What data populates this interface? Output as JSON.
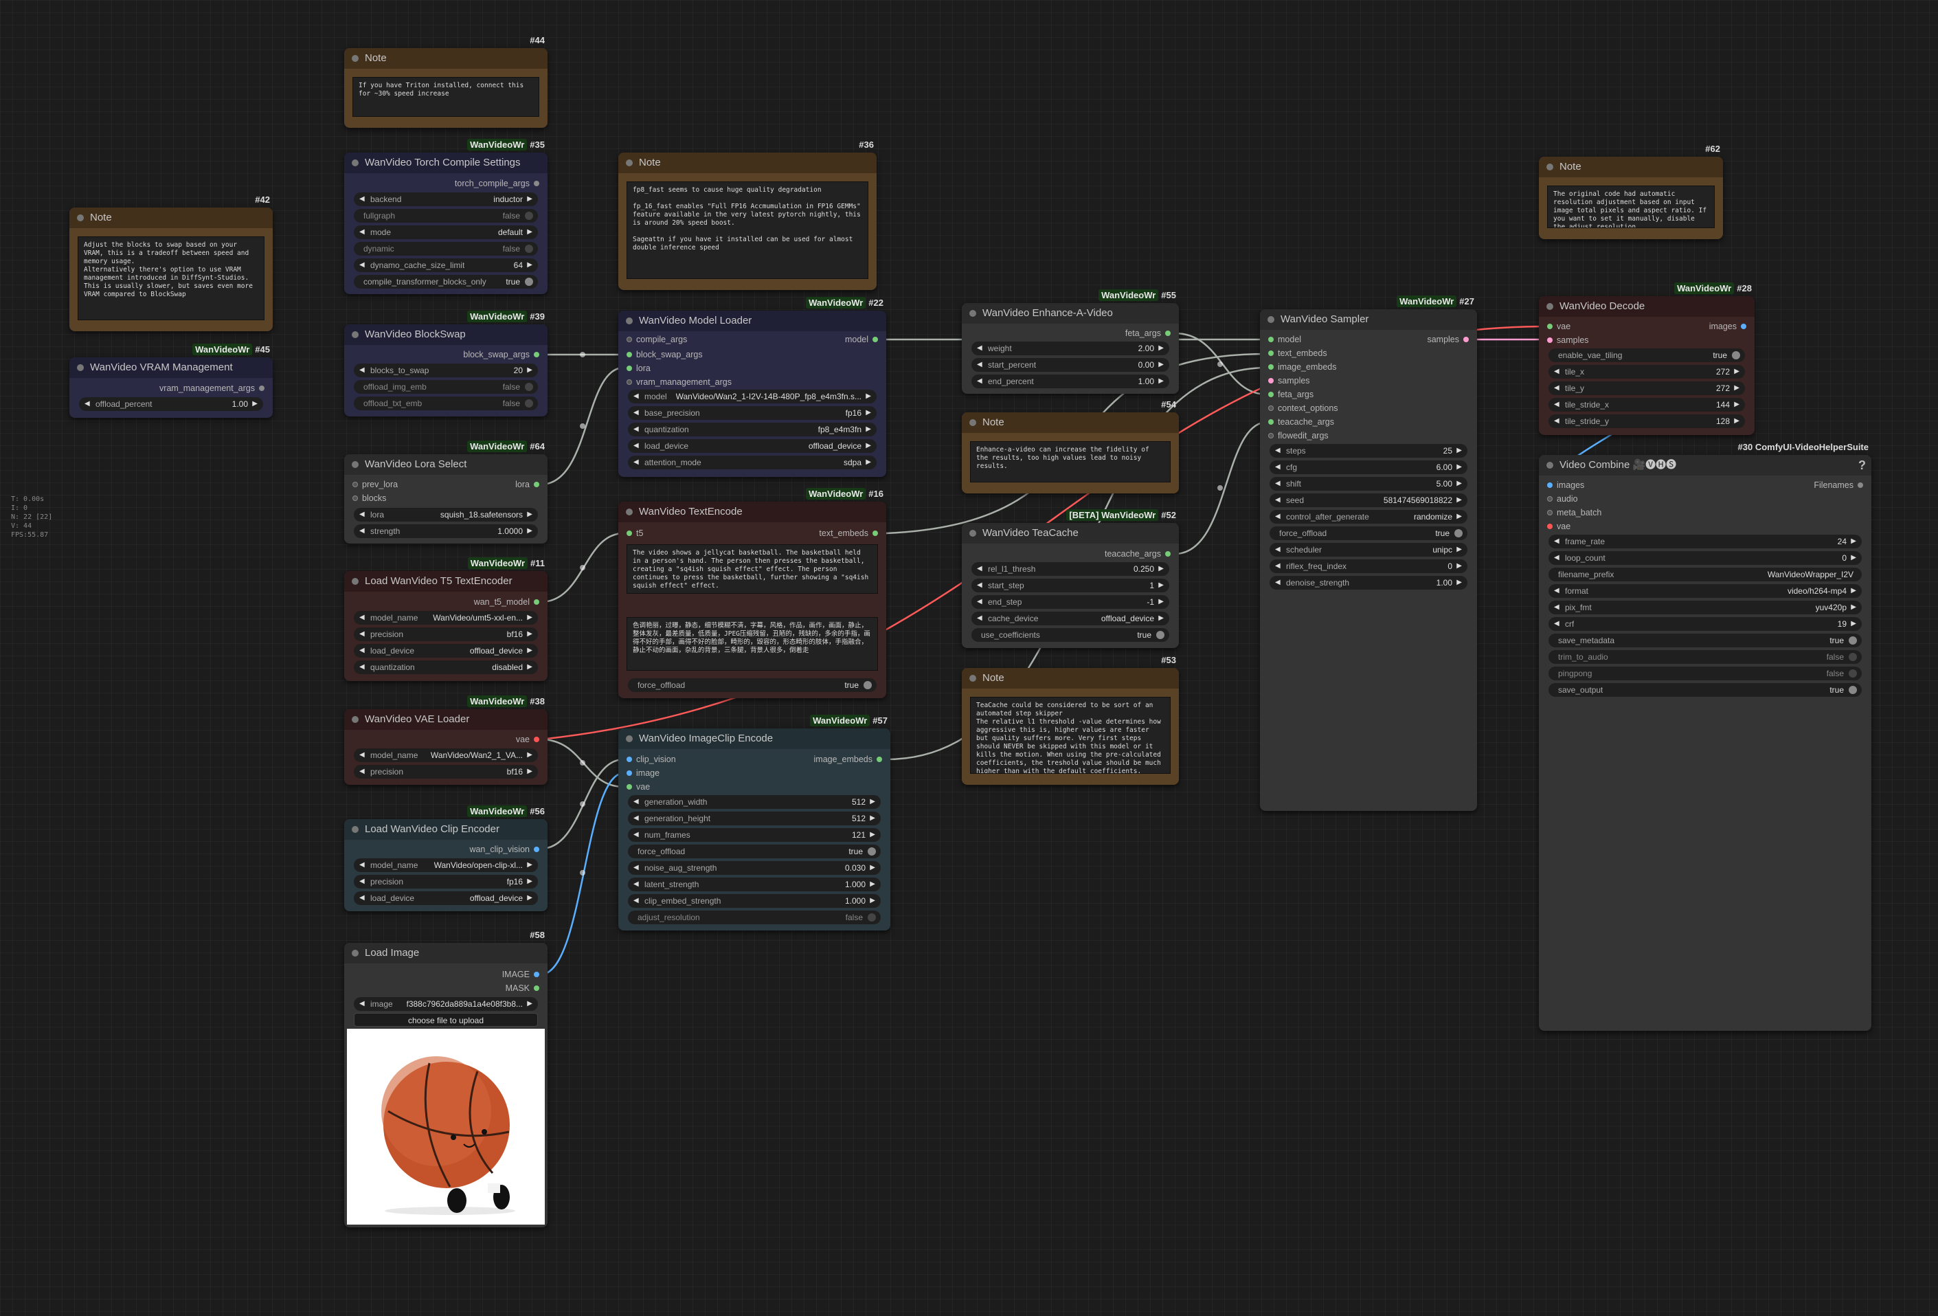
{
  "stats": [
    "T: 0.00s",
    "I: 0",
    "N: 22 [22]",
    "V: 44",
    "FPS:55.87"
  ],
  "nodes": {
    "n44": {
      "id": "#44",
      "title": "Note",
      "text": "If you have Triton installed, connect this for ~30% speed increase"
    },
    "n42": {
      "id": "#42",
      "title": "Note",
      "text": "Adjust the blocks to swap based on your VRAM, this is a tradeoff between speed and memory usage.\nAlternatively there's option to use VRAM management introduced in DiffSynt-Studios. This is usually slower, but saves even more VRAM compared to BlockSwap"
    },
    "n36": {
      "id": "#36",
      "title": "Note",
      "text": "fp8_fast seems to cause huge quality degradation\n\nfp_16_fast enables \"Full FP16 Accmumulation in FP16 GEMMs\" feature available in the very latest pytorch nightly, this is around 20% speed boost.\n\nSageattn if you have it installed can be used for almost double inference speed"
    },
    "n62": {
      "id": "#62",
      "title": "Note",
      "text": "The original code had automatic resolution adjustment based on input image total pixels and aspect ratio. If you want to set it manually, disable the adjust_resolution"
    },
    "n54": {
      "id": "#54",
      "title": "Note",
      "text": "Enhance-a-video can increase the fidelity of the results, too high values lead to noisy results."
    },
    "n53": {
      "id": "#53",
      "title": "Note",
      "text": "TeaCache could be considered to be sort of an automated step skipper\nThe relative l1 threshold -value determines how aggressive this is, higher values are faster but quality suffers more. Very first steps should NEVER be skipped with this model or it kills the motion. When using the pre-calculated coefficients, the treshold value should be much higher than with the default coefficients."
    },
    "n35": {
      "badge": "WanVideoWr",
      "id": "#35",
      "title": "WanVideo Torch Compile Settings",
      "output": "torch_compile_args",
      "widgets": [
        [
          "backend",
          "inductor"
        ],
        [
          "fullgraph",
          "false"
        ],
        [
          "mode",
          "default"
        ],
        [
          "dynamic",
          "false"
        ],
        [
          "dynamo_cache_size_limit",
          "64"
        ],
        [
          "compile_transformer_blocks_only",
          "true"
        ]
      ]
    },
    "n39": {
      "badge": "WanVideoWr",
      "id": "#39",
      "title": "WanVideo BlockSwap",
      "output": "block_swap_args",
      "widgets": [
        [
          "blocks_to_swap",
          "20"
        ],
        [
          "offload_img_emb",
          "false"
        ],
        [
          "offload_txt_emb",
          "false"
        ]
      ]
    },
    "n45": {
      "badge": "WanVideoWr",
      "id": "#45",
      "title": "WanVideo VRAM Management",
      "output": "vram_management_args",
      "widgets": [
        [
          "offload_percent",
          "1.00"
        ]
      ]
    },
    "n64": {
      "badge": "WanVideoWr",
      "id": "#64",
      "title": "WanVideo Lora Select",
      "inputs": [
        "prev_lora",
        "blocks"
      ],
      "output": "lora",
      "widgets": [
        [
          "lora",
          "squish_18.safetensors"
        ],
        [
          "strength",
          "1.0000"
        ]
      ]
    },
    "n11": {
      "badge": "WanVideoWr",
      "id": "#11",
      "title": "Load WanVideo T5 TextEncoder",
      "output": "wan_t5_model",
      "widgets": [
        [
          "model_name",
          "WanVideo/umt5-xxl-en..."
        ],
        [
          "precision",
          "bf16"
        ],
        [
          "load_device",
          "offload_device"
        ],
        [
          "quantization",
          "disabled"
        ]
      ]
    },
    "n38": {
      "badge": "WanVideoWr",
      "id": "#38",
      "title": "WanVideo VAE Loader",
      "output": "vae",
      "widgets": [
        [
          "model_name",
          "WanVideo/Wan2_1_VA..."
        ],
        [
          "precision",
          "bf16"
        ]
      ]
    },
    "n56": {
      "badge": "WanVideoWr",
      "id": "#56",
      "title": "Load WanVideo Clip Encoder",
      "output": "wan_clip_vision",
      "widgets": [
        [
          "model_name",
          "WanVideo/open-clip-xl..."
        ],
        [
          "precision",
          "fp16"
        ],
        [
          "load_device",
          "offload_device"
        ]
      ]
    },
    "n58": {
      "id": "#58",
      "title": "Load Image",
      "outputs": [
        "IMAGE",
        "MASK"
      ],
      "widgets": [
        [
          "image",
          "f388c7962da889a1a4e08f3b8..."
        ]
      ],
      "upload": "choose file to upload"
    },
    "n22": {
      "badge": "WanVideoWr",
      "id": "#22",
      "title": "WanVideo Model Loader",
      "inputs": [
        "compile_args",
        "block_swap_args",
        "lora",
        "vram_management_args"
      ],
      "output": "model",
      "widgets": [
        [
          "model",
          "WanVideo/Wan2_1-I2V-14B-480P_fp8_e4m3fn.s..."
        ],
        [
          "base_precision",
          "fp16"
        ],
        [
          "quantization",
          "fp8_e4m3fn"
        ],
        [
          "load_device",
          "offload_device"
        ],
        [
          "attention_mode",
          "sdpa"
        ]
      ]
    },
    "n16": {
      "badge": "WanVideoWr",
      "id": "#16",
      "title": "WanVideo TextEncode",
      "input": "t5",
      "output": "text_embeds",
      "positive": "The video shows a jellycat basketball. The basketball held in a person's hand. The person then presses the basketball, creating a \"sq4ish squish effect\" effect. The person continues to press the basketball, further showing a \"sq4ish squish effect\" effect.",
      "negative": "色调艳丽，过曝，静态，细节模糊不清，字幕，风格，作品，画作，画面，静止，整体发灰，最差质量，低质量，JPEG压缩残留，丑陋的，残缺的，多余的手指，画得不好的手部，画得不好的脸部，畸形的，毁容的，形态畸形的肢体，手指融合，静止不动的画面，杂乱的背景，三条腿，背景人很多，倒着走",
      "widgets": [
        [
          "force_offload",
          "true"
        ]
      ]
    },
    "n57": {
      "badge": "WanVideoWr",
      "id": "#57",
      "title": "WanVideo ImageClip Encode",
      "inputs": [
        "clip_vision",
        "image",
        "vae"
      ],
      "output": "image_embeds",
      "widgets": [
        [
          "generation_width",
          "512"
        ],
        [
          "generation_height",
          "512"
        ],
        [
          "num_frames",
          "121"
        ],
        [
          "force_offload",
          "true"
        ],
        [
          "noise_aug_strength",
          "0.030"
        ],
        [
          "latent_strength",
          "1.000"
        ],
        [
          "clip_embed_strength",
          "1.000"
        ],
        [
          "adjust_resolution",
          "false"
        ]
      ]
    },
    "n55": {
      "badge": "WanVideoWr",
      "id": "#55",
      "title": "WanVideo Enhance-A-Video",
      "output": "feta_args",
      "widgets": [
        [
          "weight",
          "2.00"
        ],
        [
          "start_percent",
          "0.00"
        ],
        [
          "end_percent",
          "1.00"
        ]
      ]
    },
    "n52": {
      "badge": "[BETA] WanVideoWr",
      "id": "#52",
      "title": "WanVideo TeaCache",
      "output": "teacache_args",
      "widgets": [
        [
          "rel_l1_thresh",
          "0.250"
        ],
        [
          "start_step",
          "1"
        ],
        [
          "end_step",
          "-1"
        ],
        [
          "cache_device",
          "offload_device"
        ],
        [
          "use_coefficients",
          "true"
        ]
      ]
    },
    "n27": {
      "badge": "WanVideoWr",
      "id": "#27",
      "title": "WanVideo Sampler",
      "inputs": [
        "model",
        "text_embeds",
        "image_embeds",
        "samples",
        "feta_args",
        "context_options",
        "teacache_args",
        "flowedit_args"
      ],
      "output": "samples",
      "widgets": [
        [
          "steps",
          "25"
        ],
        [
          "cfg",
          "6.00"
        ],
        [
          "shift",
          "5.00"
        ],
        [
          "seed",
          "581474569018822"
        ],
        [
          "control_after_generate",
          "randomize"
        ],
        [
          "force_offload",
          "true"
        ],
        [
          "scheduler",
          "unipc"
        ],
        [
          "riflex_freq_index",
          "0"
        ],
        [
          "denoise_strength",
          "1.00"
        ]
      ]
    },
    "n28": {
      "badge": "WanVideoWr",
      "id": "#28",
      "title": "WanVideo Decode",
      "inputs": [
        "vae",
        "samples"
      ],
      "output": "images",
      "widgets": [
        [
          "enable_vae_tiling",
          "true"
        ],
        [
          "tile_x",
          "272"
        ],
        [
          "tile_y",
          "272"
        ],
        [
          "tile_stride_x",
          "144"
        ],
        [
          "tile_stride_y",
          "128"
        ]
      ]
    },
    "n30": {
      "id": "#30 ComfyUI-VideoHelperSuite",
      "title": "Video Combine 🎥🅥🅗🅢",
      "inputs": [
        "images",
        "audio",
        "meta_batch",
        "vae"
      ],
      "output": "Filenames",
      "help": "?",
      "widgets": [
        [
          "frame_rate",
          "24"
        ],
        [
          "loop_count",
          "0"
        ],
        [
          "filename_prefix",
          "WanVideoWrapper_I2V"
        ],
        [
          "format",
          "video/h264-mp4"
        ],
        [
          "pix_fmt",
          "yuv420p"
        ],
        [
          "crf",
          "19"
        ],
        [
          "save_metadata",
          "true"
        ],
        [
          "trim_to_audio",
          "false"
        ],
        [
          "pingpong",
          "false"
        ],
        [
          "save_output",
          "true"
        ]
      ]
    }
  },
  "colors": {
    "canvas": "#1c1c1c",
    "wire_green": "#9ad29a",
    "wire_blue": "#5ab0ff",
    "wire_red": "#ff5a5a",
    "wire_pink": "#ff9ccf",
    "note": "#5a4227",
    "model_blue": "#2a2a45",
    "encoder_brown": "#3a2424",
    "clip_teal": "#2b3a40"
  }
}
